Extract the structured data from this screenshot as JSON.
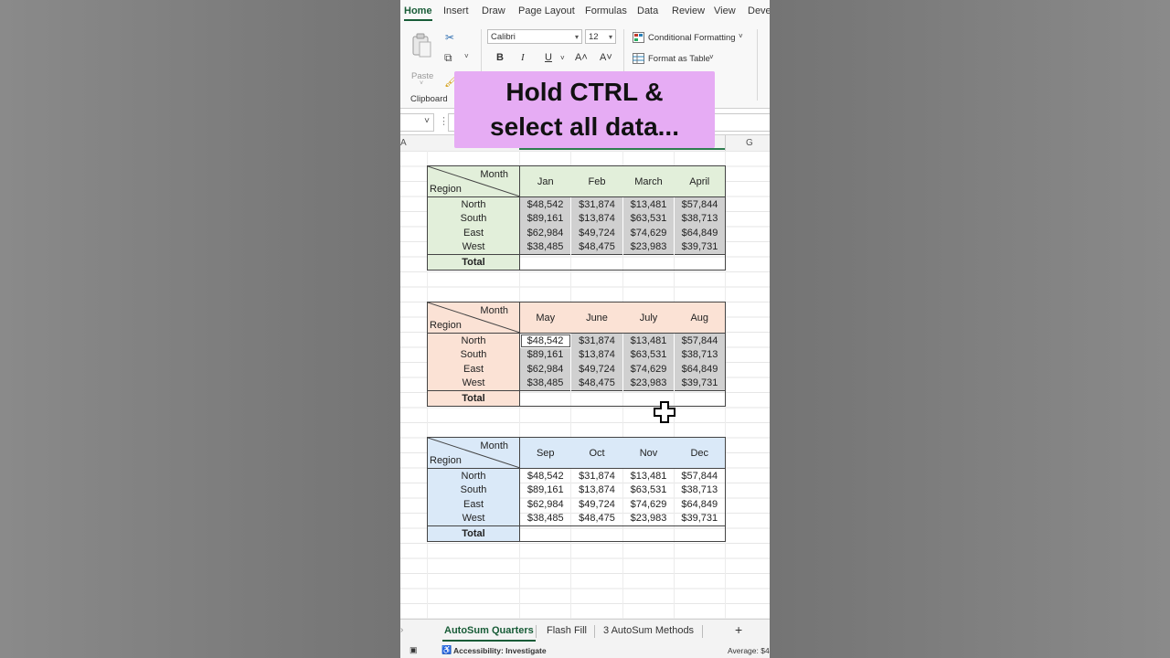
{
  "ribbon_tabs": [
    "Home",
    "Insert",
    "Draw",
    "Page Layout",
    "Formulas",
    "Data",
    "Review",
    "View",
    "Deve"
  ],
  "ribbon": {
    "paste_label": "Paste",
    "clipboard_label": "Clipboard",
    "font_name": "Calibri",
    "font_size": "12",
    "bold": "B",
    "italic": "I",
    "underline": "U",
    "grow_font": "A˄",
    "shrink_font": "A˅",
    "conditional_formatting": "Conditional Formatting",
    "format_as_table": "Format as Table"
  },
  "columns": {
    "a": "A",
    "g": "G"
  },
  "overlay_caption": {
    "line1": "Hold CTRL &",
    "line2": "select all data..."
  },
  "corner": {
    "month": "Month",
    "region": "Region"
  },
  "total_label": "Total",
  "tables": [
    {
      "header_color": "#e2efda",
      "months": [
        "Jan",
        "Feb",
        "March",
        "April"
      ],
      "rows": [
        {
          "region": "North",
          "values": [
            "$48,542",
            "$31,874",
            "$13,481",
            "$57,844"
          ]
        },
        {
          "region": "South",
          "values": [
            "$89,161",
            "$13,874",
            "$63,531",
            "$38,713"
          ]
        },
        {
          "region": "East",
          "values": [
            "$62,984",
            "$49,724",
            "$74,629",
            "$64,849"
          ]
        },
        {
          "region": "West",
          "values": [
            "$38,485",
            "$48,475",
            "$23,983",
            "$39,731"
          ]
        }
      ]
    },
    {
      "header_color": "#fbe2d5",
      "months": [
        "May",
        "June",
        "July",
        "Aug"
      ],
      "rows": [
        {
          "region": "North",
          "values": [
            "$48,542",
            "$31,874",
            "$13,481",
            "$57,844"
          ]
        },
        {
          "region": "South",
          "values": [
            "$89,161",
            "$13,874",
            "$63,531",
            "$38,713"
          ]
        },
        {
          "region": "East",
          "values": [
            "$62,984",
            "$49,724",
            "$74,629",
            "$64,849"
          ]
        },
        {
          "region": "West",
          "values": [
            "$38,485",
            "$48,475",
            "$23,983",
            "$39,731"
          ]
        }
      ]
    },
    {
      "header_color": "#dae9f8",
      "months": [
        "Sep",
        "Oct",
        "Nov",
        "Dec"
      ],
      "rows": [
        {
          "region": "North",
          "values": [
            "$48,542",
            "$31,874",
            "$13,481",
            "$57,844"
          ]
        },
        {
          "region": "South",
          "values": [
            "$89,161",
            "$13,874",
            "$63,531",
            "$38,713"
          ]
        },
        {
          "region": "East",
          "values": [
            "$62,984",
            "$49,724",
            "$74,629",
            "$64,849"
          ]
        },
        {
          "region": "West",
          "values": [
            "$38,485",
            "$48,475",
            "$23,983",
            "$39,731"
          ]
        }
      ]
    }
  ],
  "sheet_tabs": [
    "AutoSum Quarters",
    "Flash Fill",
    "3 AutoSum Methods"
  ],
  "add_sheet": "+",
  "status": {
    "accessibility": "Accessibility: Investigate",
    "average": "Average: $4"
  }
}
